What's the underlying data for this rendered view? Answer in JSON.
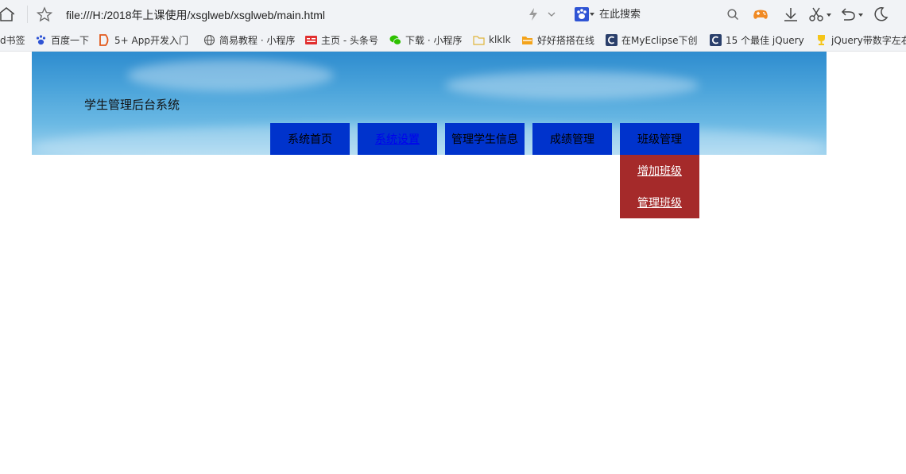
{
  "browser": {
    "url": "file:///H:/2018年上课使用/xsglweb/xsglweb/main.html",
    "search": {
      "placeholder": "在此搜索"
    },
    "icons": [
      "home-icon",
      "star-icon",
      "bolt-icon",
      "chevron-down-icon",
      "baidu-paw-icon",
      "search-icon",
      "game-icon",
      "download-icon",
      "scissors-icon",
      "undo-icon",
      "moon-icon"
    ]
  },
  "bookmarks": [
    {
      "label": "d书签",
      "icon": "none"
    },
    {
      "label": "百度一下",
      "icon": "baidu-paw-icon"
    },
    {
      "label": "5+ App开发入门",
      "icon": "dcloud-icon"
    },
    {
      "label": "简易教程 · 小程序",
      "icon": "globe-icon"
    },
    {
      "label": "主页 - 头条号",
      "icon": "toutiao-icon"
    },
    {
      "label": "下载 · 小程序",
      "icon": "wechat-icon"
    },
    {
      "label": "klklk",
      "icon": "folder-icon"
    },
    {
      "label": "好好搭搭在线",
      "icon": "folder-icon"
    },
    {
      "label": "在MyEclipse下创",
      "icon": "c-blog-icon"
    },
    {
      "label": "15 个最佳 jQuery",
      "icon": "c-blog-icon"
    },
    {
      "label": "jQuery带数字左右",
      "icon": "trophy-icon"
    }
  ],
  "page": {
    "site_title": "学生管理后台系统",
    "nav": [
      {
        "label": "系统首页"
      },
      {
        "label": "系统设置"
      },
      {
        "label": "管理学生信息"
      },
      {
        "label": "成绩管理"
      },
      {
        "label": "班级管理"
      }
    ],
    "dropdown": [
      {
        "label": "增加班级"
      },
      {
        "label": "管理班级"
      }
    ],
    "colors": {
      "nav_bg": "#0033cc",
      "dropdown_bg": "#a52a2a"
    }
  }
}
